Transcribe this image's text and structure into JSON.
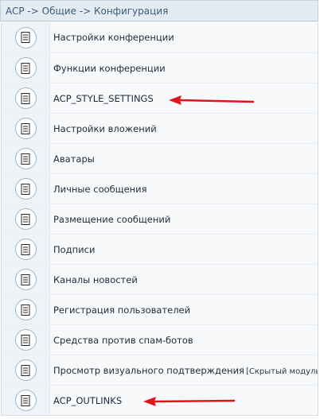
{
  "breadcrumb": "ACP -> Общие -> Конфигурация",
  "items": [
    {
      "label": "Настройки конференции",
      "hint": ""
    },
    {
      "label": "Функции конференции",
      "hint": ""
    },
    {
      "label": "ACP_STYLE_SETTINGS",
      "hint": ""
    },
    {
      "label": "Настройки вложений",
      "hint": ""
    },
    {
      "label": "Аватары",
      "hint": ""
    },
    {
      "label": "Личные сообщения",
      "hint": ""
    },
    {
      "label": "Размещение сообщений",
      "hint": ""
    },
    {
      "label": "Подписи",
      "hint": ""
    },
    {
      "label": "Каналы новостей",
      "hint": ""
    },
    {
      "label": "Регистрация пользователей",
      "hint": ""
    },
    {
      "label": "Средства против спам-ботов",
      "hint": ""
    },
    {
      "label": "Просмотр визуального подтверждения",
      "hint": "[Скрытый модуль]"
    },
    {
      "label": "ACP_OUTLINKS",
      "hint": ""
    }
  ],
  "icon": "document-icon",
  "colors": {
    "arrow": "#e0141b",
    "header_bg": "#e4ecf3"
  }
}
